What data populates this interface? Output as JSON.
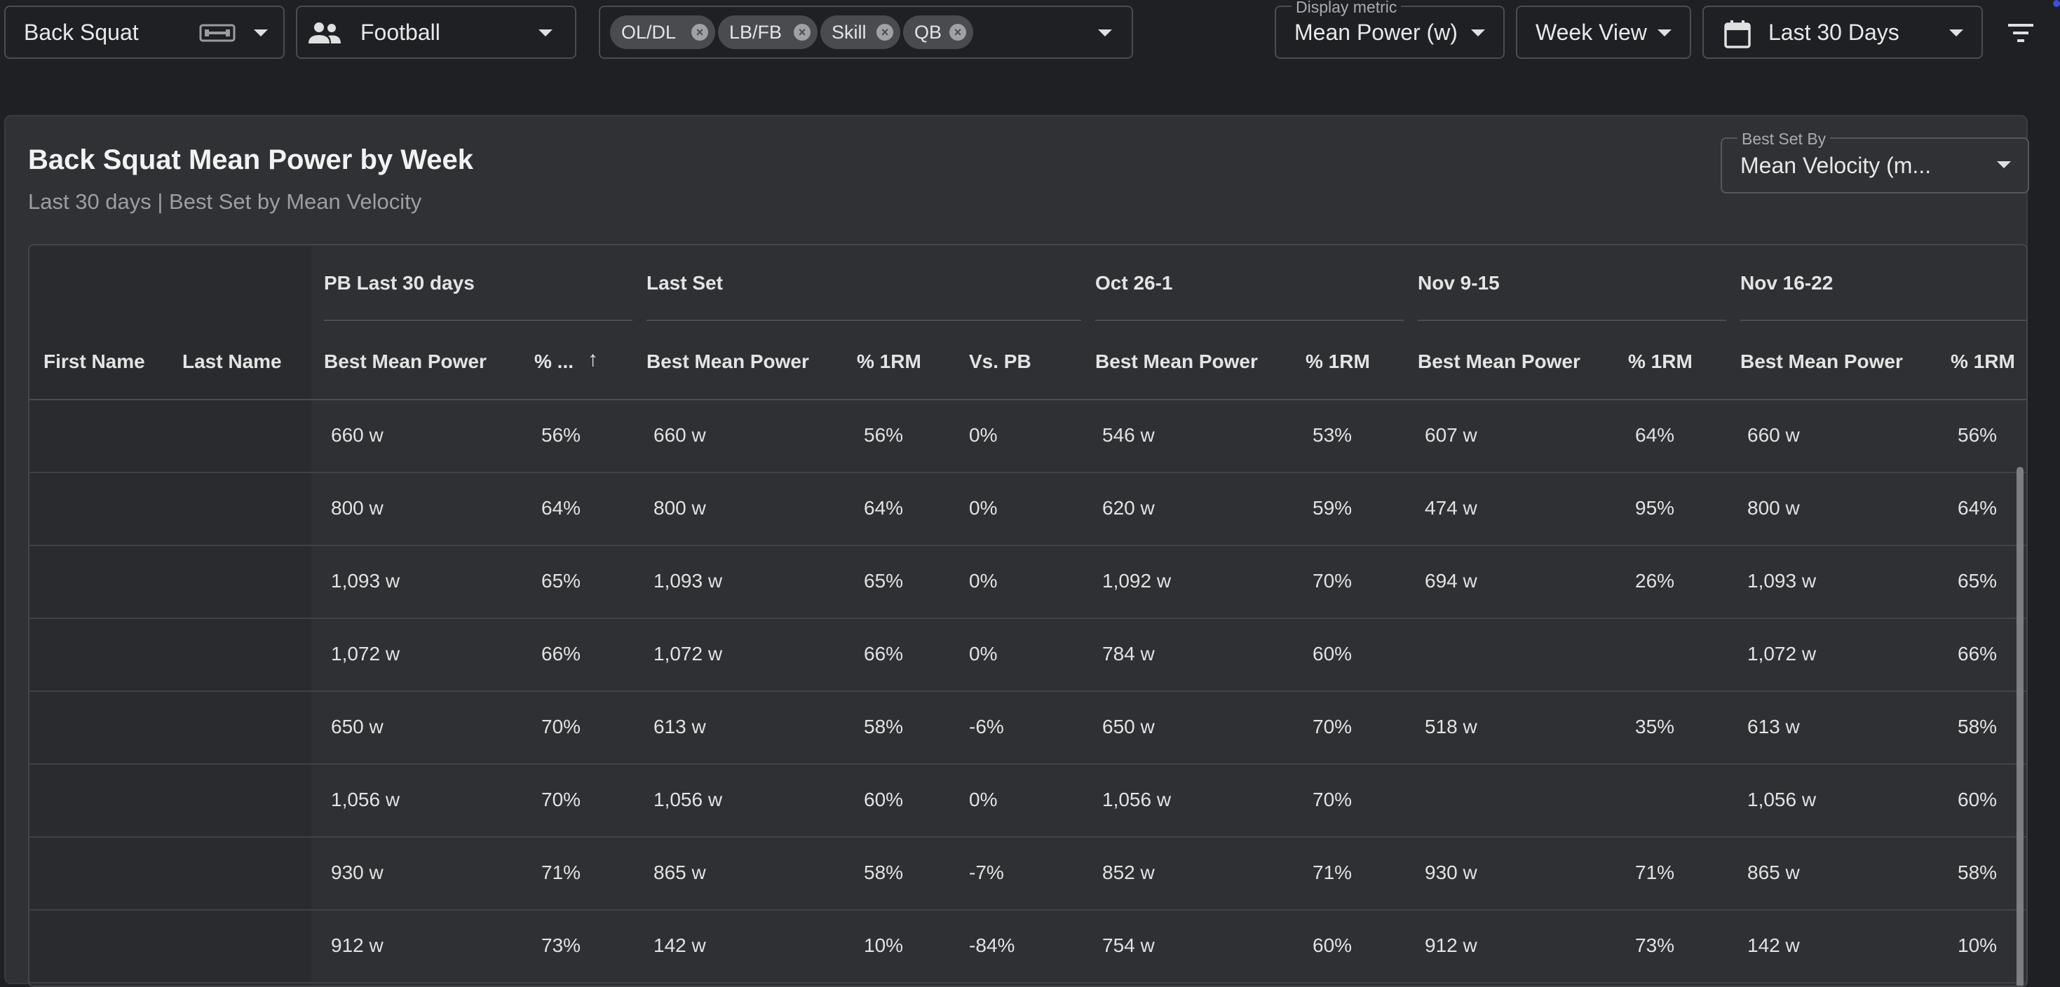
{
  "toolbar": {
    "exercise": "Back Squat",
    "exercise_icon": "barbell-icon",
    "team": "Football",
    "team_icon": "people-icon",
    "groups": [
      "OL/DL",
      "LB/FB",
      "Skill",
      "QB"
    ],
    "display_metric_label": "Display metric",
    "display_metric": "Mean Power (w)",
    "view": "Week View",
    "date_range": "Last 30 Days",
    "calendar_icon": "calendar-icon",
    "filter_icon": "filter-icon"
  },
  "card": {
    "title": "Back Squat Mean Power by Week",
    "subtitle": "Last 30 days | Best Set by Mean Velocity",
    "best_set_label": "Best Set By",
    "best_set_value": "Mean Velocity (m..."
  },
  "table": {
    "name_headers": [
      "First Name",
      "Last Name"
    ],
    "groups": [
      {
        "label": "PB Last 30 days",
        "columns": [
          "Best Mean Power",
          "% ..."
        ]
      },
      {
        "label": "Last Set",
        "columns": [
          "Best Mean Power",
          "% 1RM",
          "Vs. PB"
        ]
      },
      {
        "label": "Oct 26-1",
        "columns": [
          "Best Mean Power",
          "% 1RM"
        ]
      },
      {
        "label": "Nov 9-15",
        "columns": [
          "Best Mean Power",
          "% 1RM"
        ]
      },
      {
        "label": "Nov 16-22",
        "columns": [
          "Best Mean Power",
          "% 1RM"
        ]
      }
    ],
    "rows": [
      [
        "660 w",
        "56%",
        "660 w",
        "56%",
        "0%",
        "546 w",
        "53%",
        "607 w",
        "64%",
        "660 w",
        "56%"
      ],
      [
        "800 w",
        "64%",
        "800 w",
        "64%",
        "0%",
        "620 w",
        "59%",
        "474 w",
        "95%",
        "800 w",
        "64%"
      ],
      [
        "1,093 w",
        "65%",
        "1,093 w",
        "65%",
        "0%",
        "1,092 w",
        "70%",
        "694 w",
        "26%",
        "1,093 w",
        "65%"
      ],
      [
        "1,072 w",
        "66%",
        "1,072 w",
        "66%",
        "0%",
        "784 w",
        "60%",
        "",
        "",
        "1,072 w",
        "66%"
      ],
      [
        "650 w",
        "70%",
        "613 w",
        "58%",
        "-6%",
        "650 w",
        "70%",
        "518 w",
        "35%",
        "613 w",
        "58%"
      ],
      [
        "1,056 w",
        "70%",
        "1,056 w",
        "60%",
        "0%",
        "1,056 w",
        "70%",
        "",
        "",
        "1,056 w",
        "60%"
      ],
      [
        "930 w",
        "71%",
        "865 w",
        "58%",
        "-7%",
        "852 w",
        "71%",
        "930 w",
        "71%",
        "865 w",
        "58%"
      ],
      [
        "912 w",
        "73%",
        "142 w",
        "10%",
        "-84%",
        "754 w",
        "60%",
        "912 w",
        "73%",
        "142 w",
        "10%"
      ]
    ]
  }
}
